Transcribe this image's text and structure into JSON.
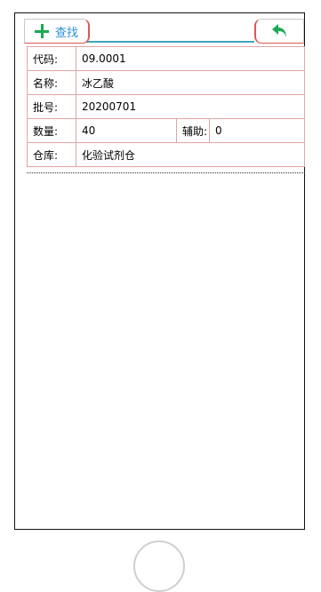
{
  "toolbar": {
    "find_label": "查找",
    "accent_color": "#1aaa55",
    "find_icon": "plus-icon",
    "back_icon": "back-arrow-icon"
  },
  "fields": {
    "code_label": "代码:",
    "code_value": "09.0001",
    "name_label": "名称:",
    "name_value": "冰乙酸",
    "batch_label": "批号:",
    "batch_value": "20200701",
    "qty_label": "数量:",
    "qty_value": "40",
    "aux_label": "辅助:",
    "aux_value": "0",
    "warehouse_label": "仓库:",
    "warehouse_value": "化验试剂仓"
  }
}
